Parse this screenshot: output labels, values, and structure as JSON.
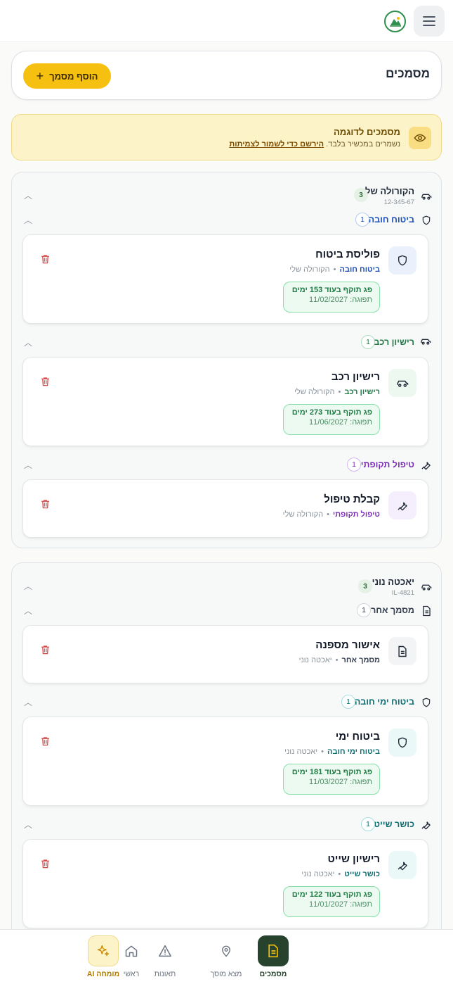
{
  "header": {
    "title": "מסמכים",
    "add_label": "הוסף מסמך"
  },
  "banner": {
    "title": "מסמכים לדוגמה",
    "sub_text": "נשמרים במכשיר בלבד.",
    "link_text": "הירשם כדי לשמור לצמיתות"
  },
  "vehicles": [
    {
      "name": "הקורולה שלי",
      "plate": "12-345-67",
      "count": "3",
      "categories": [
        {
          "label": "ביטוח חובה",
          "count": "1",
          "color": "#1d4fb8",
          "doc": {
            "title": "פוליסת ביטוח",
            "category": "ביטוח חובה",
            "vehicle": "הקורולה שלי",
            "expiry": "פג תוקף בעוד 153 ימים",
            "date": "תפוגה: 11/02/2027"
          }
        },
        {
          "label": "רישיון רכב",
          "count": "1",
          "color": "#1f7a44",
          "doc": {
            "title": "רישיון רכב",
            "category": "רישיון רכב",
            "vehicle": "הקורולה שלי",
            "expiry": "פג תוקף בעוד 273 ימים",
            "date": "תפוגה: 11/06/2027"
          }
        },
        {
          "label": "טיפול תקופתי",
          "count": "1",
          "color": "#7b2fb5",
          "doc": {
            "title": "קבלת טיפול",
            "category": "טיפול תקופתי",
            "vehicle": "הקורולה שלי"
          }
        }
      ]
    },
    {
      "name": "יאכטה נוני",
      "plate": "IL-4821",
      "count": "3",
      "categories": [
        {
          "label": "מסמך אחר",
          "count": "1",
          "color": "#374151",
          "doc": {
            "title": "אישור מספנה",
            "category": "מסמך אחר",
            "vehicle": "יאכטה נוני"
          }
        },
        {
          "label": "ביטוח ימי חובה",
          "count": "1",
          "color": "#0f6f73",
          "doc": {
            "title": "ביטוח ימי",
            "category": "ביטוח ימי חובה",
            "vehicle": "יאכטה נוני",
            "expiry": "פג תוקף בעוד 181 ימים",
            "date": "תפוגה: 11/03/2027"
          }
        },
        {
          "label": "כושר שייט",
          "count": "1",
          "color": "#0f6f73",
          "doc": {
            "title": "רישיון שייט",
            "category": "כושר שייט",
            "vehicle": "יאכטה נוני",
            "expiry": "פג תוקף בעוד 122 ימים",
            "date": "תפוגה: 11/01/2027"
          }
        }
      ]
    }
  ],
  "nav": {
    "home": "ראשי",
    "documents": "מסמכים",
    "find_garage": "מצא מוסך",
    "accidents": "תאונות",
    "ai_expert": "מומחה AI"
  },
  "colors": {
    "accent": "#f5c010",
    "nav_active": "#27432e",
    "expiry_green": "#1f7a44",
    "trash_red": "#d84a4a"
  }
}
